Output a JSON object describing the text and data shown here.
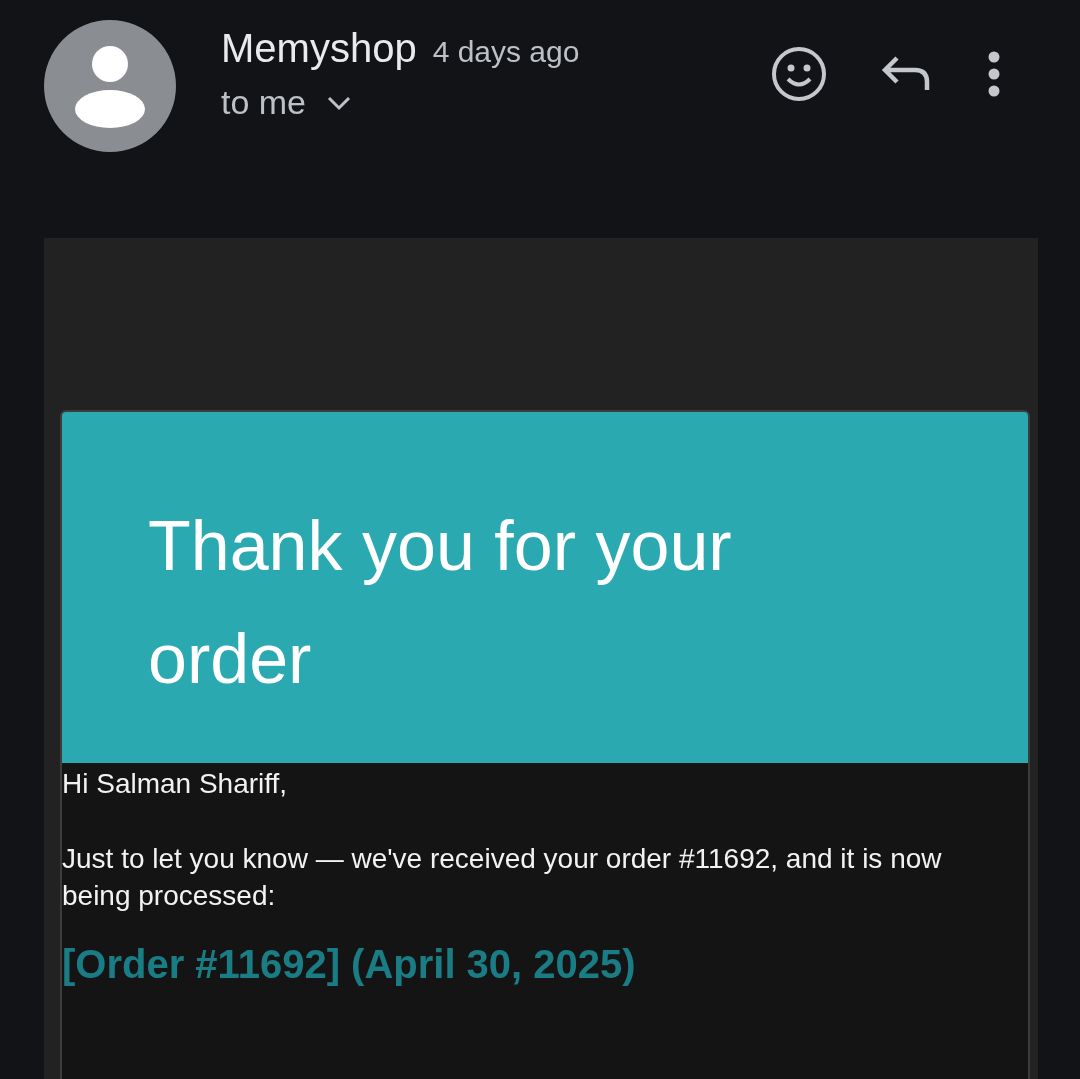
{
  "header": {
    "sender": "Memyshop",
    "time": "4 days ago",
    "recipient": "to me"
  },
  "email": {
    "banner_title": "Thank you for your order",
    "greeting": "Hi Salman Shariff,",
    "message": "Just to let you know — we've received your order #11692, and it is now being processed:",
    "order_heading": "[Order #11692] (April 30, 2025)"
  }
}
